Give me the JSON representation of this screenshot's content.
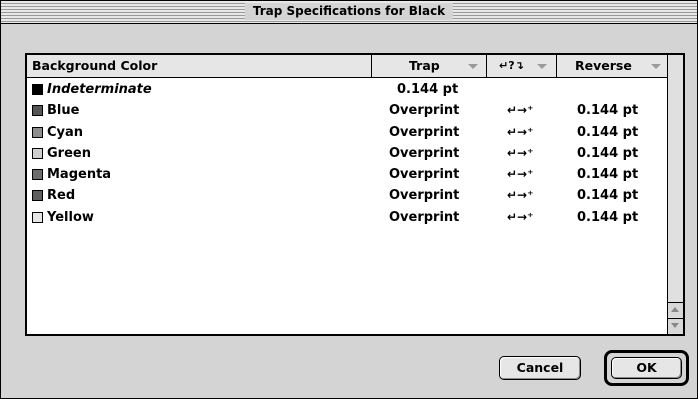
{
  "window": {
    "title": "Trap Specifications for Black"
  },
  "table": {
    "headers": {
      "background_color": "Background Color",
      "trap": "Trap",
      "auto": "↵?↴",
      "reverse": "Reverse"
    },
    "rows": [
      {
        "color": "Indeterminate",
        "swatch": "#000000",
        "italic": true,
        "trap": "0.144  pt",
        "auto": "",
        "reverse": ""
      },
      {
        "color": "Blue",
        "swatch": "#555555",
        "italic": false,
        "trap": "Overprint",
        "auto": "↵→⁺",
        "reverse": "0.144  pt"
      },
      {
        "color": "Cyan",
        "swatch": "#8c8c8c",
        "italic": false,
        "trap": "Overprint",
        "auto": "↵→⁺",
        "reverse": "0.144  pt"
      },
      {
        "color": "Green",
        "swatch": "#cfcfcf",
        "italic": false,
        "trap": "Overprint",
        "auto": "↵→⁺",
        "reverse": "0.144  pt"
      },
      {
        "color": "Magenta",
        "swatch": "#6c6c6c",
        "italic": false,
        "trap": "Overprint",
        "auto": "↵→⁺",
        "reverse": "0.144  pt"
      },
      {
        "color": "Red",
        "swatch": "#5e5e5e",
        "italic": false,
        "trap": "Overprint",
        "auto": "↵→⁺",
        "reverse": "0.144  pt"
      },
      {
        "color": "Yellow",
        "swatch": "#e6e6e6",
        "italic": false,
        "trap": "Overprint",
        "auto": "↵→⁺",
        "reverse": "0.144  pt"
      }
    ]
  },
  "buttons": {
    "cancel": "Cancel",
    "ok": "OK"
  },
  "icons": {
    "scroll_up": "scroll-up-arrow-icon",
    "scroll_down": "scroll-down-arrow-icon",
    "menu": "dropdown-triangle-icon"
  }
}
